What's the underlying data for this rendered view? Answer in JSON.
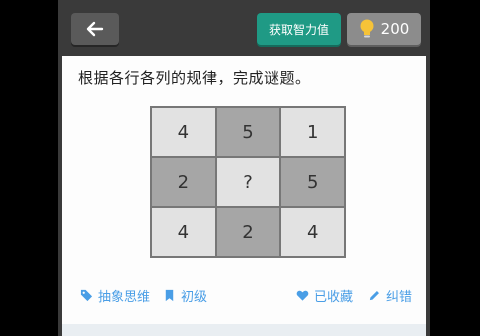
{
  "header": {
    "hint_label": "获取智力值",
    "points": "200"
  },
  "question": {
    "text": "根据各行各列的规律，完成谜题。"
  },
  "grid": {
    "cells": [
      {
        "value": "4",
        "shade": "light"
      },
      {
        "value": "5",
        "shade": "dark"
      },
      {
        "value": "1",
        "shade": "light"
      },
      {
        "value": "2",
        "shade": "dark"
      },
      {
        "value": "?",
        "shade": "light"
      },
      {
        "value": "5",
        "shade": "dark"
      },
      {
        "value": "4",
        "shade": "light"
      },
      {
        "value": "2",
        "shade": "dark"
      },
      {
        "value": "4",
        "shade": "light"
      }
    ]
  },
  "footer": {
    "category": "抽象思维",
    "level": "初级",
    "favorite": "已收藏",
    "report": "纠错"
  },
  "colors": {
    "accent_green": "#1f9a85",
    "link_blue": "#4a9ee6",
    "bulb_yellow": "#f6c338"
  }
}
